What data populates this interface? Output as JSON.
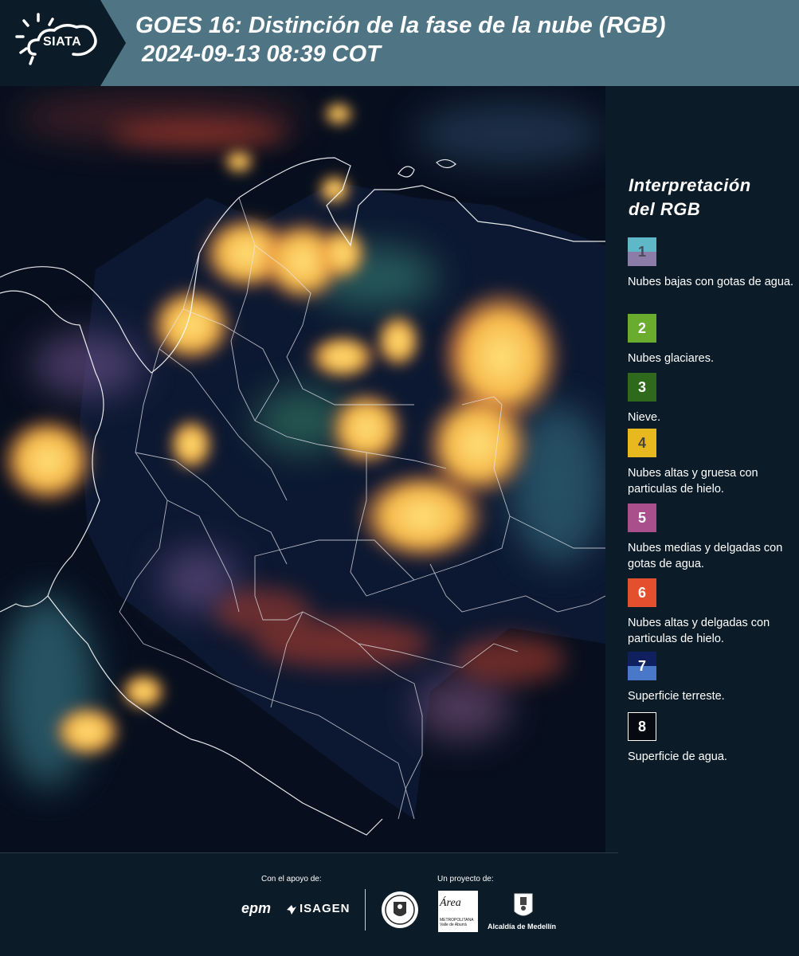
{
  "header": {
    "logo_label": "SIATA",
    "title_line1": "GOES 16: Distinción de la fase de la nube (RGB)",
    "title_line2": "2024-09-13 08:39 COT",
    "background_color": "#4f7585"
  },
  "legend": {
    "title_line1": "Interpretación",
    "title_line2": "del RGB",
    "items": [
      {
        "number": "1",
        "label": "Nubes bajas con gotas de agua.",
        "color_top": "#5fb8c8",
        "color_bottom": "#8c7ca8",
        "number_color": "#4a4a5a"
      },
      {
        "number": "2",
        "label": "Nubes glaciares.",
        "color_top": "#6aac2e",
        "color_bottom": "#6aac2e",
        "number_color": "#ffffff"
      },
      {
        "number": "3",
        "label": "Nieve.",
        "color_top": "#2f6a1c",
        "color_bottom": "#2f6a1c",
        "number_color": "#ffffff"
      },
      {
        "number": "4",
        "label": "Nubes altas y gruesa con particulas de hielo.",
        "color_top": "#e8b91e",
        "color_bottom": "#e8b91e",
        "number_color": "#444444"
      },
      {
        "number": "5",
        "label": "Nubes medias y delgadas con gotas de agua.",
        "color_top": "#a94f8c",
        "color_bottom": "#a94f8c",
        "number_color": "#ffffff"
      },
      {
        "number": "6",
        "label": "Nubes altas y delgadas con particulas de hielo.",
        "color_top": "#e4502e",
        "color_bottom": "#e4502e",
        "number_color": "#ffffff"
      },
      {
        "number": "7",
        "label": "Superficie terreste.",
        "color_top": "#10205e",
        "color_bottom": "#4a78c8",
        "number_color": "#ffffff"
      },
      {
        "number": "8",
        "label": "Superficie de agua.",
        "color_top": "#060a10",
        "color_bottom": "#060a10",
        "number_color": "#ffffff"
      }
    ]
  },
  "footer": {
    "support_label": "Con el apoyo de:",
    "project_label": "Un proyecto de:",
    "epm_label": "epm",
    "isagen_label": "ISAGEN",
    "area_label": "Área",
    "area_sub_line1": "METROPOLITANA",
    "area_sub_line2": "Valle de Aburrá",
    "alcaldia_label": "Alcaldía de Medellín"
  }
}
